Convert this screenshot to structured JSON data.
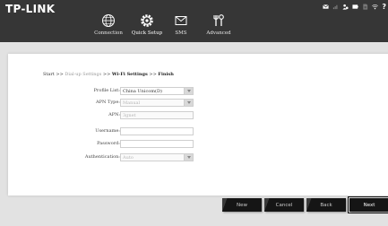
{
  "header": {
    "logo": "TP-LINK",
    "nav": [
      {
        "label": "Connection",
        "icon": "globe-icon",
        "active": false
      },
      {
        "label": "Quick Setup",
        "icon": "gear-icon",
        "active": true
      },
      {
        "label": "SMS",
        "icon": "envelope-icon",
        "active": false
      },
      {
        "label": "Advanced",
        "icon": "tools-icon",
        "active": false
      }
    ],
    "status_icons": [
      "sms-indicator-icon",
      "signal-icon",
      "wifi-clients-icon",
      "battery-icon",
      "sim-icon",
      "wifi-icon",
      "help-icon"
    ]
  },
  "breadcrumb": {
    "start": "Start",
    "dialup": "Dial-up Settings",
    "wifi": "Wi-Fi Settings",
    "finish": "Finish",
    "sep": ">>"
  },
  "form": {
    "profile_list": {
      "label": "Profile List:",
      "value": "China Unicom(D)"
    },
    "apn_type": {
      "label": "APN Type:",
      "value": "Manual"
    },
    "apn": {
      "label": "APN:",
      "value": "3gnet"
    },
    "username": {
      "label": "Username:",
      "value": ""
    },
    "password": {
      "label": "Password:",
      "value": ""
    },
    "authentication": {
      "label": "Authentication:",
      "value": "Auto"
    }
  },
  "buttons": {
    "new": "New",
    "cancel": "Cancel",
    "back": "Back",
    "next": "Next"
  },
  "colors": {
    "header_bg": "#363636",
    "page_bg": "#e2e2e2",
    "button_bg": "#151515"
  }
}
